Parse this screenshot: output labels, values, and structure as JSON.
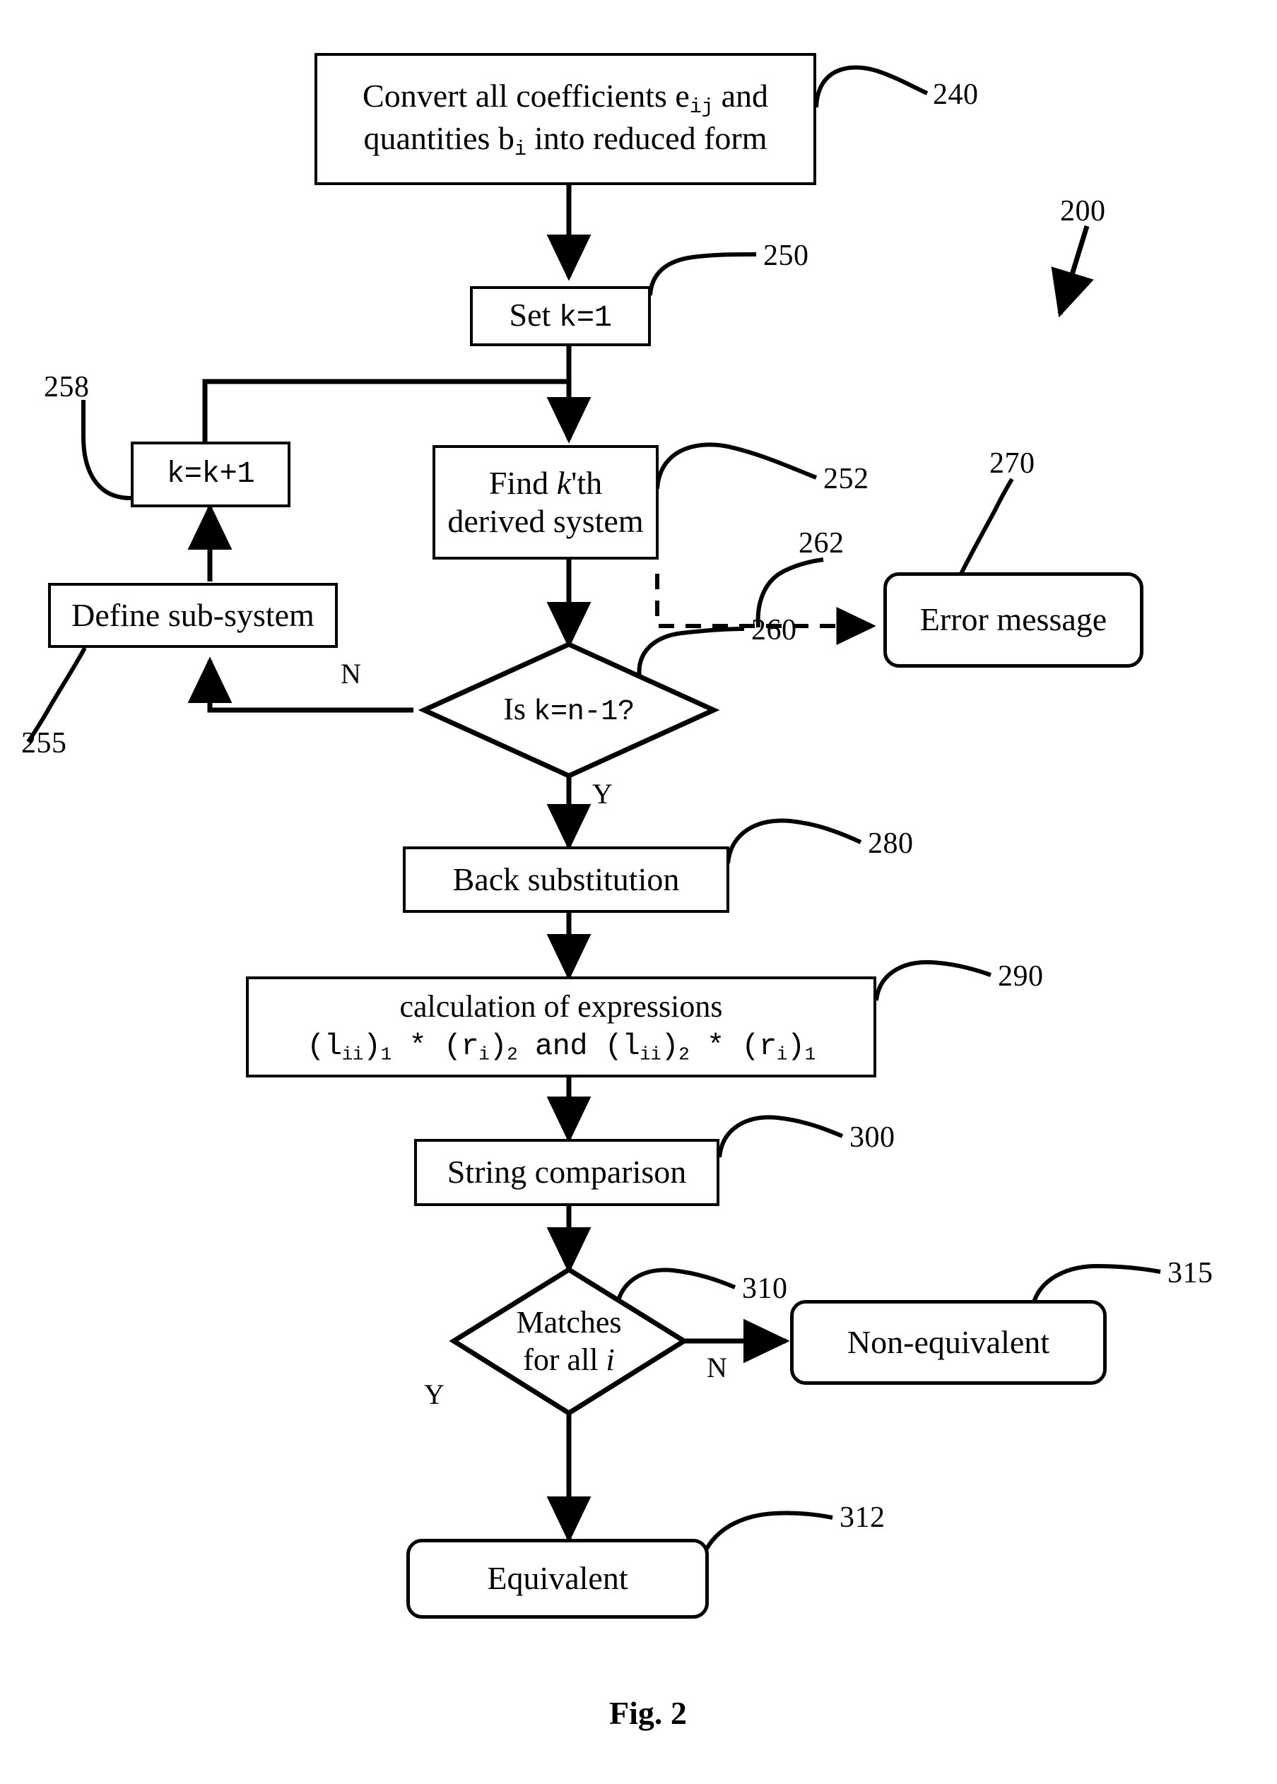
{
  "figure": {
    "caption": "Fig. 2",
    "diagram_ref": "200",
    "type": "flowchart"
  },
  "nodes": [
    {
      "id": "240",
      "shape": "rect",
      "ref": "240",
      "line1_pre": "Convert all coefficients e",
      "line1_sub": "ij",
      "line1_post": " and",
      "line2_pre": "quantities b",
      "line2_sub": "i",
      "line2_post": " into reduced form"
    },
    {
      "id": "250",
      "shape": "rect",
      "ref": "250",
      "text_pre": "Set ",
      "text_mono": "k=1"
    },
    {
      "id": "258",
      "shape": "rect",
      "ref": "258",
      "text_mono": "k=k+1"
    },
    {
      "id": "252",
      "shape": "rect",
      "ref": "252",
      "line1_pre": "Find ",
      "line1_ital": "k",
      "line1_post": "'th",
      "line2": "derived system"
    },
    {
      "id": "255",
      "shape": "rect",
      "ref": "255",
      "text": "Define sub-system"
    },
    {
      "id": "260",
      "shape": "diamond",
      "ref": "260",
      "text_pre": "Is ",
      "text_mono": "k=n-1?"
    },
    {
      "id": "270",
      "shape": "rounded",
      "ref": "270",
      "text": "Error message"
    },
    {
      "id": "280",
      "shape": "rect",
      "ref": "280",
      "text": "Back substitution"
    },
    {
      "id": "290",
      "shape": "rect",
      "ref": "290",
      "line1": "calculation of expressions",
      "line2_a": "(l",
      "line2_a_sub": "ii",
      "line2_b": ")",
      "line2_b_sub": "1",
      "line2_c": " *  (r",
      "line2_c_sub": "i",
      "line2_d": ")",
      "line2_d_sub": "2",
      "line2_e": " and (l",
      "line2_e_sub": "ii",
      "line2_f": ")",
      "line2_f_sub": "2",
      "line2_g": " *  (r",
      "line2_g_sub": "i",
      "line2_h": ")",
      "line2_h_sub": "1"
    },
    {
      "id": "300",
      "shape": "rect",
      "ref": "300",
      "text": "String comparison"
    },
    {
      "id": "310",
      "shape": "diamond",
      "ref": "310",
      "line1": "Matches",
      "line2_pre": "for all ",
      "line2_ital": "i"
    },
    {
      "id": "315",
      "shape": "rounded",
      "ref": "315",
      "text": "Non-equivalent"
    },
    {
      "id": "312",
      "shape": "rounded",
      "ref": "312",
      "text": "Equivalent"
    }
  ],
  "refs": {
    "r200": "200",
    "r240": "240",
    "r250": "250",
    "r252": "252",
    "r255": "255",
    "r258": "258",
    "r260": "260",
    "r262": "262",
    "r270": "270",
    "r280": "280",
    "r290": "290",
    "r300": "300",
    "r310": "310",
    "r312": "312",
    "r315": "315"
  },
  "branch_labels": {
    "n_from_260": "N",
    "y_from_260": "Y",
    "n_from_310": "N",
    "y_from_310": "Y"
  },
  "colors": {
    "ink": "#000000",
    "paper": "#ffffff"
  }
}
